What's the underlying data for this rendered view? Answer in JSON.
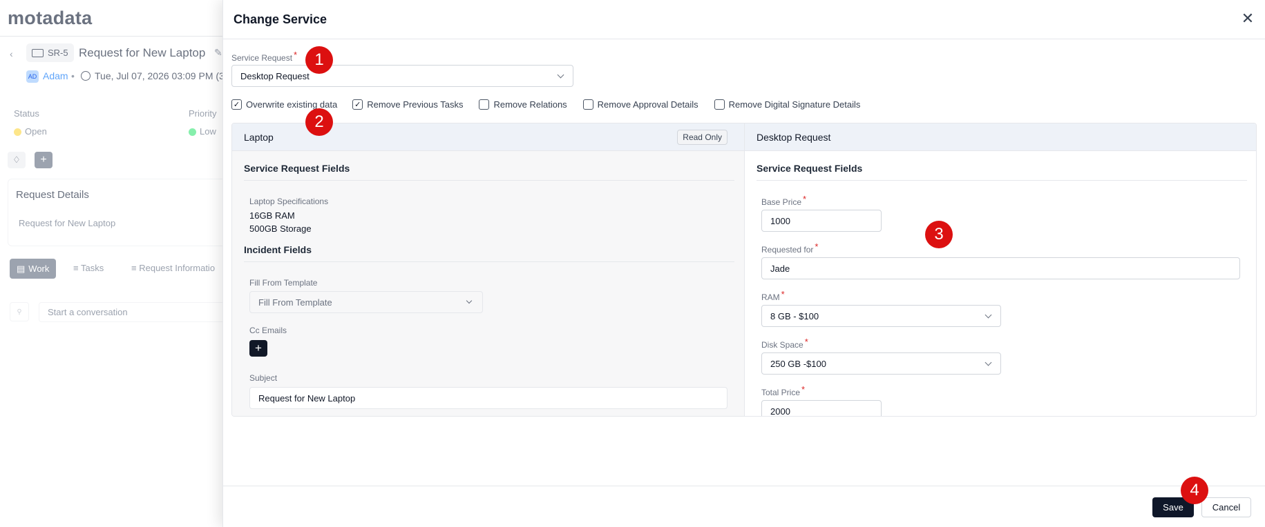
{
  "background": {
    "logo": "motadata",
    "ticket_id": "SR-5",
    "request_title": "Request for New Laptop",
    "requester_initials": "AD",
    "requester_name": "Adam",
    "separator": "•",
    "created_at": "Tue, Jul 07, 2026 03:09 PM (3",
    "status_label": "Status",
    "status_value": "Open",
    "priority_label": "Priority",
    "priority_value": "Low",
    "request_details_title": "Request Details",
    "request_details_value": "Request for New Laptop",
    "tabs": {
      "work": "Work",
      "tasks": "Tasks",
      "request_information": "Request Informatio"
    },
    "conversation_placeholder": "Start a conversation"
  },
  "modal": {
    "title": "Change Service",
    "service_request": {
      "label": "Service Request",
      "value": "Desktop Request"
    },
    "options": [
      {
        "label": "Overwrite existing data",
        "checked": true
      },
      {
        "label": "Remove Previous Tasks",
        "checked": true
      },
      {
        "label": "Remove Relations",
        "checked": false
      },
      {
        "label": "Remove Approval Details",
        "checked": false
      },
      {
        "label": "Remove Digital Signature Details",
        "checked": false
      }
    ],
    "left": {
      "title": "Laptop",
      "badge": "Read Only",
      "sr_fields_title": "Service Request Fields",
      "laptop_specs_label": "Laptop Specifications",
      "laptop_specs_line1": "16GB RAM",
      "laptop_specs_line2": "500GB Storage",
      "incident_fields_title": "Incident Fields",
      "fill_template_label": "Fill From Template",
      "fill_template_value": "Fill From Template",
      "cc_emails_label": "Cc Emails",
      "subject_label": "Subject",
      "subject_value": "Request for New Laptop"
    },
    "right": {
      "title": "Desktop Request",
      "sr_fields_title": "Service Request Fields",
      "base_price_label": "Base Price",
      "base_price_value": "1000",
      "requested_for_label": "Requested for",
      "requested_for_value": "Jade",
      "ram_label": "RAM",
      "ram_value": "8 GB - $100",
      "disk_label": "Disk Space",
      "disk_value": "250 GB -$100",
      "total_label": "Total Price",
      "total_value": "2000"
    },
    "save_label": "Save",
    "cancel_label": "Cancel"
  },
  "markers": [
    "1",
    "2",
    "3",
    "4"
  ],
  "colors": {
    "primary_dark": "#0f1729",
    "marker_red": "#dc1010",
    "required_star": "#dc2626"
  }
}
